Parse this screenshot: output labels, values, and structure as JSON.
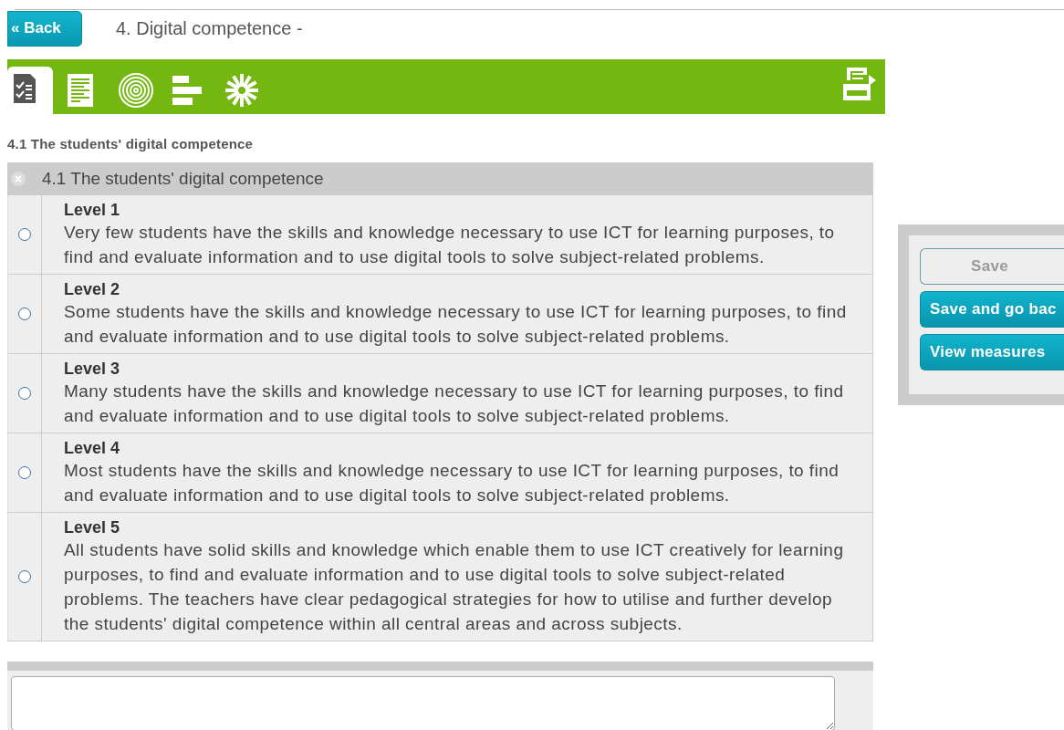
{
  "header": {
    "back_button": "« Back",
    "title": "4. Digital competence -"
  },
  "toolbar": {
    "tabs": [
      {
        "kind": "checklist",
        "selected": true
      },
      {
        "kind": "document",
        "selected": false
      },
      {
        "kind": "target",
        "selected": false
      },
      {
        "kind": "bars",
        "selected": false
      },
      {
        "kind": "burst",
        "selected": false
      }
    ]
  },
  "section_heading": "4.1 The students' digital competence",
  "criterion": {
    "title": "4.1 The students' digital competence",
    "expanded": true,
    "levels": [
      {
        "label": "Level 1",
        "description": "Very few students have the skills and knowledge necessary to use ICT for learning purposes, to find and evaluate information and to use digital tools to solve subject-related problems.",
        "selected": false
      },
      {
        "label": "Level 2",
        "description": "Some students have the skills and knowledge necessary to use ICT for learning purposes, to find and evaluate information and to use digital tools to solve subject-related problems.",
        "selected": false
      },
      {
        "label": "Level 3",
        "description": "Many students have the skills and knowledge necessary to use ICT for learning purposes, to find and evaluate information and to use digital tools to solve subject-related problems.",
        "selected": false
      },
      {
        "label": "Level 4",
        "description": "Most students have the skills and knowledge necessary to use ICT for learning purposes, to find and evaluate information and to use digital tools to solve subject-related problems.",
        "selected": false
      },
      {
        "label": "Level 5",
        "description": "All students have solid skills and knowledge which enable them to use ICT creatively for learning purposes, to find and evaluate information and to use digital tools to solve subject-related problems. The teachers have clear pedagogical strategies for how to utilise and further develop the students' digital competence within all central areas and across subjects.",
        "selected": false
      }
    ]
  },
  "side_panel": {
    "buttons": [
      {
        "label": "Save",
        "disabled": true
      },
      {
        "label": "Save and go bac",
        "disabled": false
      },
      {
        "label": "View measures",
        "disabled": false
      }
    ]
  }
}
